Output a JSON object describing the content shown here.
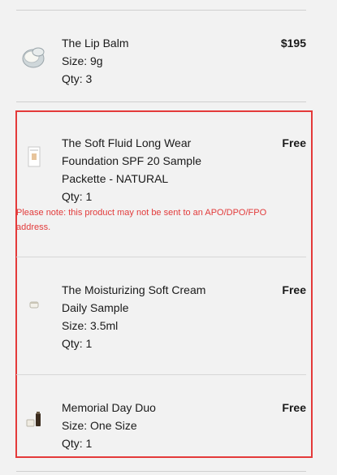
{
  "items": [
    {
      "title": "The Lip Balm",
      "size": "Size: 9g",
      "qty": "Qty: 3",
      "price": "$195",
      "thumb_icon": "lip-balm-jar-icon"
    },
    {
      "title_lines": [
        "The Soft Fluid Long Wear",
        "Foundation SPF 20 Sample",
        "Packette - NATURAL"
      ],
      "qty": "Qty: 1",
      "price": "Free",
      "note": "Please note: this product may not be sent to an APO/DPO/FPO address.",
      "thumb_icon": "foundation-packette-icon"
    },
    {
      "title_lines": [
        "The Moisturizing Soft Cream",
        "Daily Sample"
      ],
      "size": "Size: 3.5ml",
      "qty": "Qty: 1",
      "price": "Free",
      "thumb_icon": "cream-sample-icon"
    },
    {
      "title": "Memorial Day Duo",
      "size": "Size: One Size",
      "qty": "Qty: 1",
      "price": "Free",
      "thumb_icon": "duo-kit-icon"
    }
  ],
  "colors": {
    "highlight_border": "#e43a3a",
    "note_text": "#e23b3b",
    "background": "#f2f2f2"
  }
}
